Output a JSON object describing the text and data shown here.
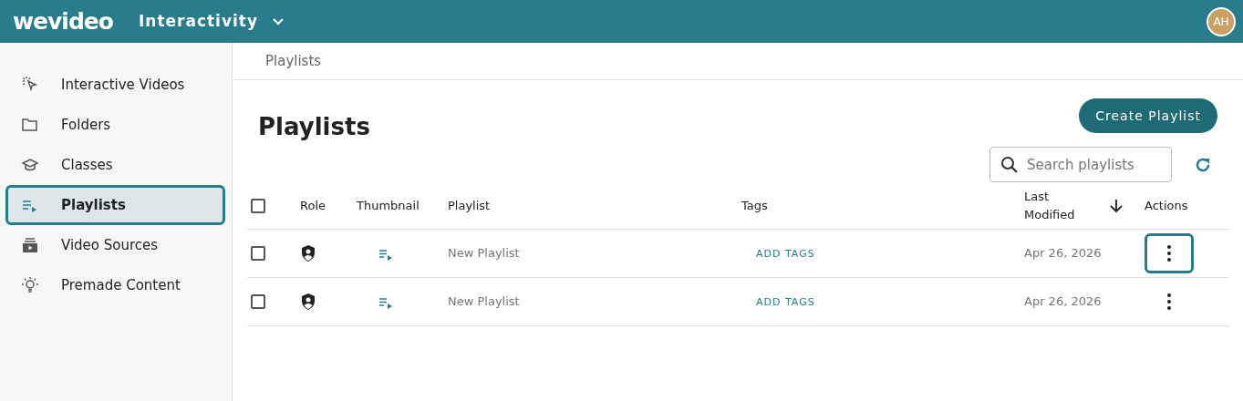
{
  "header": {
    "logo": "wevideo",
    "app_switcher": "Interactivity",
    "avatar": "AH"
  },
  "sidebar": {
    "items": [
      {
        "label": "Interactive Videos",
        "selected": false
      },
      {
        "label": "Folders",
        "selected": false
      },
      {
        "label": "Classes",
        "selected": false
      },
      {
        "label": "Playlists",
        "selected": true
      },
      {
        "label": "Video Sources",
        "selected": false
      },
      {
        "label": "Premade Content",
        "selected": false
      }
    ]
  },
  "breadcrumb": "Playlists",
  "page_title": "Playlists",
  "create_button": "Create Playlist",
  "search": {
    "placeholder": "Search playlists"
  },
  "table": {
    "select_all_checked": false,
    "columns": [
      "Role",
      "Thumbnail",
      "Playlist",
      "Tags",
      "Last Modified",
      "Actions"
    ],
    "rows": [
      {
        "checked": false,
        "playlist": "New Playlist",
        "tags": "ADD TAGS",
        "last_modified": "Apr 26, 2026",
        "focused": true
      },
      {
        "checked": false,
        "playlist": "New Playlist",
        "tags": "ADD TAGS",
        "last_modified": "Apr 26, 2026",
        "focused": false
      }
    ]
  }
}
